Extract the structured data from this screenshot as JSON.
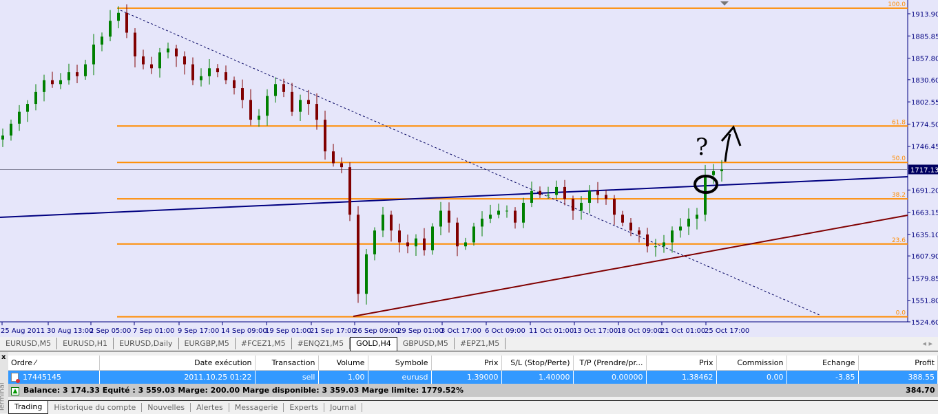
{
  "chart": {
    "symbol": "GOLD,H4",
    "current_price": "1717.13",
    "price_ticks": [
      "1913.90",
      "1885.85",
      "1857.80",
      "1830.60",
      "1802.55",
      "1774.50",
      "1746.45",
      "1691.20",
      "1663.15",
      "1635.10",
      "1607.90",
      "1579.85",
      "1551.80",
      "1524.60"
    ],
    "time_ticks": [
      "25 Aug 2011",
      "30 Aug 13:00",
      "2 Sep 05:00",
      "7 Sep 01:00",
      "9 Sep 17:00",
      "14 Sep 09:00",
      "19 Sep 01:00",
      "21 Sep 17:00",
      "26 Sep 09:00",
      "29 Sep 01:00",
      "3 Oct 17:00",
      "6 Oct 09:00",
      "11 Oct 01:00",
      "13 Oct 17:00",
      "18 Oct 09:00",
      "21 Oct 01:00",
      "25 Oct 17:00"
    ],
    "fibonacci": [
      {
        "label": "100.0",
        "price": 1921
      },
      {
        "label": "61.8",
        "price": 1772
      },
      {
        "label": "50.0",
        "price": 1726
      },
      {
        "label": "38.2",
        "price": 1680
      },
      {
        "label": "23.6",
        "price": 1623
      },
      {
        "label": "0.0",
        "price": 1531
      }
    ],
    "approx_closes": [
      1760,
      1775,
      1790,
      1800,
      1815,
      1830,
      1825,
      1830,
      1840,
      1835,
      1850,
      1875,
      1885,
      1905,
      1915,
      1890,
      1860,
      1850,
      1845,
      1865,
      1870,
      1860,
      1850,
      1830,
      1835,
      1845,
      1840,
      1830,
      1820,
      1805,
      1780,
      1785,
      1810,
      1825,
      1815,
      1790,
      1805,
      1800,
      1780,
      1740,
      1725,
      1720,
      1660,
      1560,
      1610,
      1640,
      1660,
      1640,
      1625,
      1620,
      1630,
      1615,
      1645,
      1665,
      1650,
      1620,
      1625,
      1645,
      1655,
      1660,
      1665,
      1665,
      1650,
      1675,
      1690,
      1685,
      1685,
      1695,
      1680,
      1665,
      1675,
      1690,
      1685,
      1680,
      1660,
      1650,
      1640,
      1635,
      1620,
      1620,
      1625,
      1640,
      1645,
      1655,
      1660,
      1710,
      1715,
      1717.13
    ],
    "annotation_text": "? ↑",
    "colors": {
      "background": "#e6e6fa",
      "fib": "#ff8c00",
      "bull": "#008000",
      "bear": "#800000",
      "trend_blue": "#000080",
      "trend_red": "#800000"
    }
  },
  "chart_tabs": [
    "EURUSD,M5",
    "EURUSD,H1",
    "EURUSD,Daily",
    "EURGBP,M5",
    "#FCEZ1,M5",
    "#ENQZ1,M5",
    "GOLD,H4",
    "GBPUSD,M5",
    "#EPZ1,M5"
  ],
  "active_chart_tab": "GOLD,H4",
  "terminal": {
    "label": "Terminal",
    "close": "x",
    "columns": [
      "Ordre  ⁄",
      "Date exécution",
      "Transaction",
      "Volume",
      "Symbole",
      "Prix",
      "S/L (Stop/Perte)",
      "T/P (Prendre/pr...",
      "Prix",
      "Commission",
      "Echange",
      "Profit"
    ],
    "order": [
      "17445145",
      "2011.10.25 01:22",
      "sell",
      "1.00",
      "eurusd",
      "1.39000",
      "1.40000",
      "0.00000",
      "1.38462",
      "0.00",
      "-3.85",
      "388.55"
    ],
    "balance_text": "Balance: 3 174.33  Equité : 3 559.03  Marge: 200.00  Marge disponible: 3 359.03  Marge limite: 1779.52%",
    "total_profit": "384.70",
    "tabs": [
      "Trading",
      "Historique du compte",
      "Nouvelles",
      "Alertes",
      "Messagerie",
      "Experts",
      "Journal"
    ]
  }
}
